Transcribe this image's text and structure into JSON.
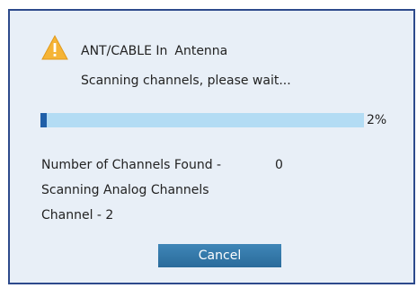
{
  "dialog": {
    "title": "ANT/CABLE In",
    "source": "Antenna",
    "message": "Scanning channels, please wait...",
    "warning_icon": "warning-triangle-icon",
    "warning_color": "#f5b436"
  },
  "progress": {
    "value": 0.02,
    "label": "2%",
    "fill_color": "#1f5fa8",
    "track_color": "#b3dcf4"
  },
  "status": {
    "channels_found_label": "Number of Channels Found -",
    "channels_found_value": "0",
    "scan_type": "Scanning Analog Channels",
    "current_channel": "Channel - 2"
  },
  "buttons": {
    "cancel_label": "Cancel"
  }
}
